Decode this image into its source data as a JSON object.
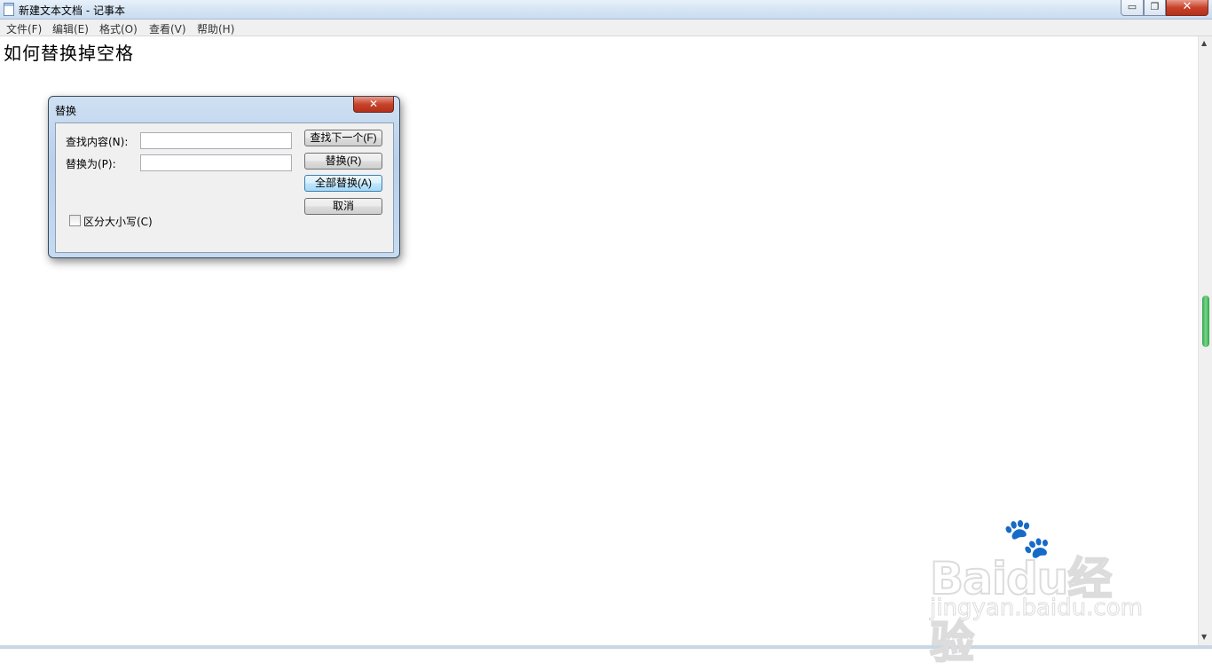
{
  "window": {
    "title": "新建文本文档 - 记事本",
    "min_glyph": "▭",
    "max_glyph": "❐",
    "close_glyph": "✕"
  },
  "menu": [
    {
      "label": "文件(F)"
    },
    {
      "label": "编辑(E)"
    },
    {
      "label": "格式(O)"
    },
    {
      "label": "查看(V)"
    },
    {
      "label": "帮助(H)"
    }
  ],
  "document": {
    "text": "如何替换掉空格"
  },
  "dialog": {
    "title": "替换",
    "close_glyph": "✕",
    "find_label": "查找内容(N):",
    "find_value": "",
    "replace_label": "替换为(P):",
    "replace_value": "",
    "find_next_button": "查找下一个(F)",
    "replace_button": "替换(R)",
    "replace_all_button": "全部替换(A)",
    "cancel_button": "取消",
    "match_case_label": "区分大小写(C)",
    "match_case_checked": false
  },
  "watermark": {
    "brand": "Baidu经验",
    "url": "jingyan.baidu.com"
  }
}
